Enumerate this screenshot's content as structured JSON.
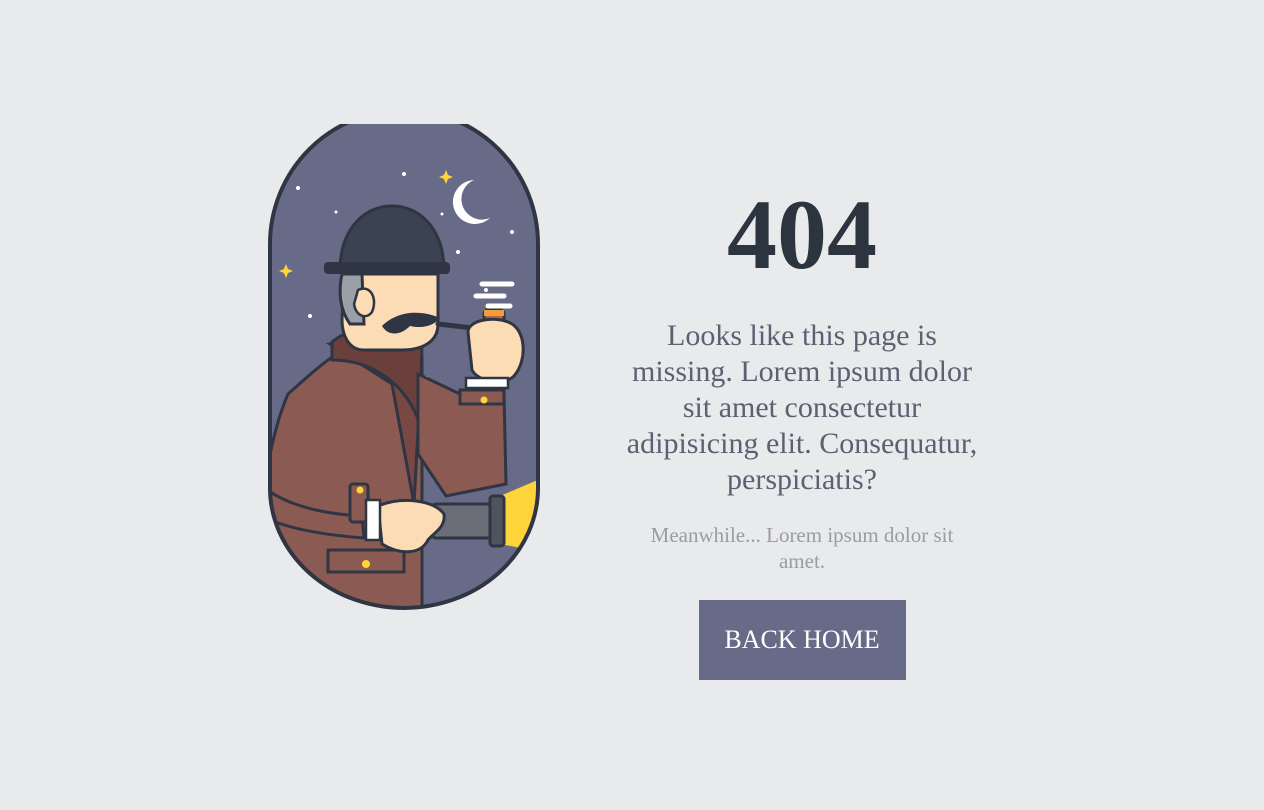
{
  "error": {
    "code": "404",
    "message": "Looks like this page is missing. Lorem ipsum dolor sit amet consectetur adipisicing elit. Consequatur, perspiciatis?",
    "sub_message": "Meanwhile... Lorem ipsum dolor sit amet.",
    "button_label": "BACK HOME"
  },
  "illustration": {
    "subject": "detective-with-pipe-and-flashlight",
    "colors": {
      "sky": "#676b87",
      "outline": "#2f3542",
      "coat": "#8b5a52",
      "hat": "#3b4250",
      "skin": "#fcdcb4",
      "light_beam": "#ffd43b",
      "moon": "#ffffff"
    }
  },
  "colors": {
    "background": "#e9eaec",
    "heading": "#2c3440",
    "body_text": "#5c6172",
    "muted_text": "#9b9ca3",
    "button_bg": "#676b87",
    "button_text": "#ffffff"
  }
}
